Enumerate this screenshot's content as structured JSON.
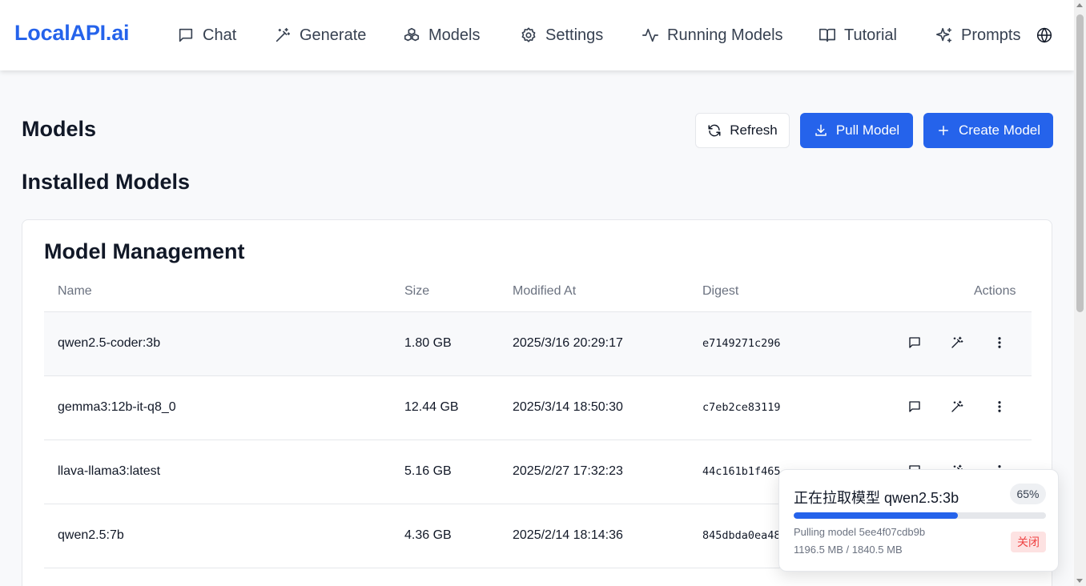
{
  "brand": "LocalAPI.ai",
  "nav": [
    {
      "label": "Chat",
      "icon": "chat-icon"
    },
    {
      "label": "Generate",
      "icon": "wand-icon"
    },
    {
      "label": "Models",
      "icon": "boxes-icon"
    },
    {
      "label": "Settings",
      "icon": "gear-icon"
    },
    {
      "label": "Running Models",
      "icon": "activity-icon"
    },
    {
      "label": "Tutorial",
      "icon": "book-icon"
    },
    {
      "label": "Prompts",
      "icon": "sparkles-icon"
    }
  ],
  "page": {
    "title": "Models",
    "refresh_label": "Refresh",
    "pull_label": "Pull Model",
    "create_label": "Create Model",
    "section_title": "Installed Models"
  },
  "card": {
    "title": "Model Management",
    "columns": [
      "Name",
      "Size",
      "Modified At",
      "Digest",
      "Actions"
    ],
    "rows": [
      {
        "name": "qwen2.5-coder:3b",
        "size": "1.80 GB",
        "modified": "2025/3/16 20:29:17",
        "digest": "e7149271c296"
      },
      {
        "name": "gemma3:12b-it-q8_0",
        "size": "12.44 GB",
        "modified": "2025/3/14 18:50:30",
        "digest": "c7eb2ce83119"
      },
      {
        "name": "llava-llama3:latest",
        "size": "5.16 GB",
        "modified": "2025/2/27 17:32:23",
        "digest": "44c161b1f465"
      },
      {
        "name": "qwen2.5:7b",
        "size": "4.36 GB",
        "modified": "2025/2/14 18:14:36",
        "digest": "845dbda0ea48"
      }
    ]
  },
  "toast": {
    "title": "正在拉取模型 qwen2.5:3b",
    "percent_label": "65%",
    "progress": 0.65,
    "status": "Pulling model 5ee4f07cdb9b",
    "bytes": "1196.5 MB / 1840.5 MB",
    "close_label": "关闭"
  },
  "colors": {
    "accent": "#2563eb",
    "close_bg": "#fde2e2",
    "close_text": "#ef4444"
  }
}
